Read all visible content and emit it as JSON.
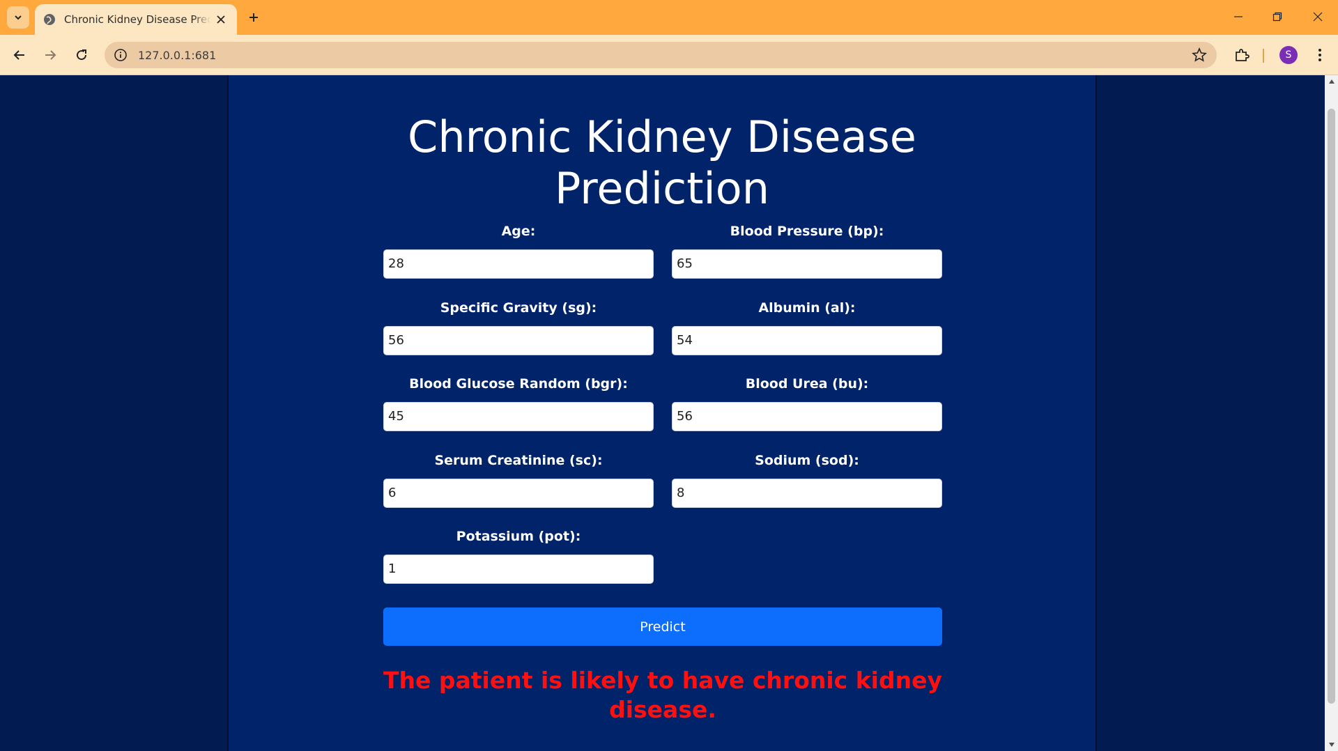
{
  "browser": {
    "tab_title": "Chronic Kidney Disease Prediction",
    "url": "127.0.0.1:681",
    "profile_initial": "S"
  },
  "page": {
    "title_line1": "Chronic Kidney Disease",
    "title_line2": "Prediction",
    "fields": [
      {
        "label": "Age:",
        "value": "28"
      },
      {
        "label": "Blood Pressure (bp):",
        "value": "65"
      },
      {
        "label": "Specific Gravity (sg):",
        "value": "56"
      },
      {
        "label": "Albumin (al):",
        "value": "54"
      },
      {
        "label": "Blood Glucose Random (bgr):",
        "value": "45"
      },
      {
        "label": "Blood Urea (bu):",
        "value": "56"
      },
      {
        "label": "Serum Creatinine (sc):",
        "value": "6"
      },
      {
        "label": "Sodium (sod):",
        "value": "8"
      },
      {
        "label": "Potassium (pot):",
        "value": "1"
      }
    ],
    "predict_label": "Predict",
    "result_text": "The patient is likely to have chronic kidney disease."
  },
  "colors": {
    "background": "#021c52",
    "card": "#002369",
    "button": "#0d6efd",
    "result": "#ff1010",
    "browser_frame": "#ffa83d"
  }
}
